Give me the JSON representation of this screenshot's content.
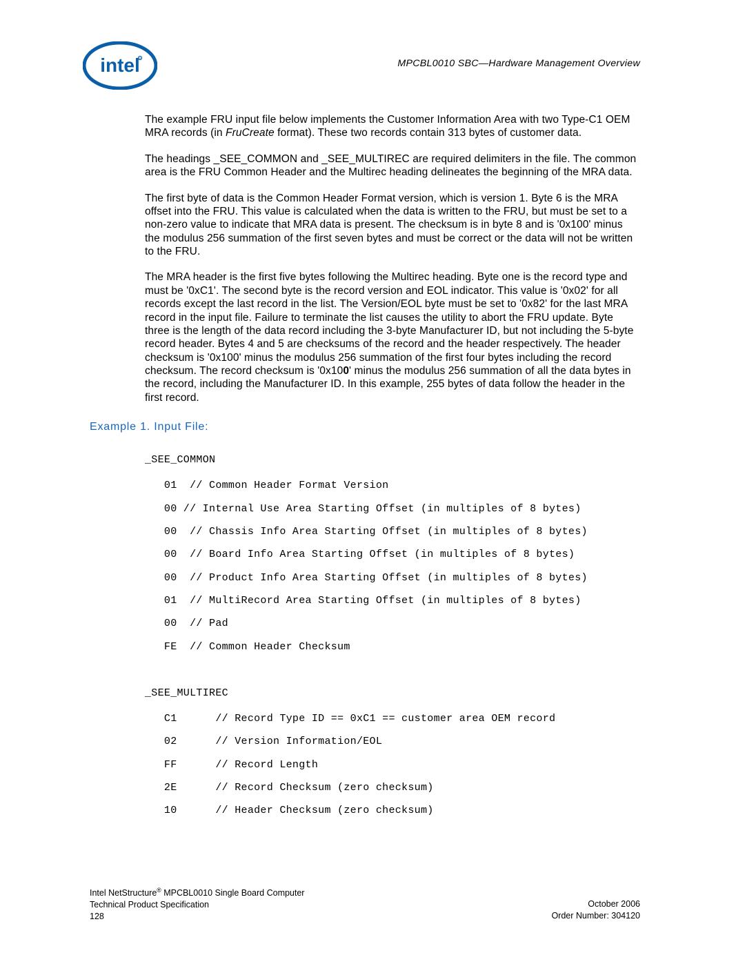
{
  "header": {
    "doc_title": "MPCBL0010 SBC—Hardware Management Overview"
  },
  "logo": {
    "name": "intel-logo"
  },
  "paragraphs": {
    "p1_a": "The example FRU input file below implements the Customer Information Area with two Type-C1 OEM MRA records (in ",
    "p1_b_italic": "FruCreate",
    "p1_c": " format). These two records contain 313 bytes of customer data.",
    "p2": "The headings _SEE_COMMON and _SEE_MULTIREC are required delimiters in the file. The common area is the FRU Common Header and the Multirec heading delineates the beginning of the MRA data.",
    "p3": "The first byte of data is the Common Header Format version, which is version 1. Byte 6 is the MRA offset into the FRU. This value is calculated when the data is written to the FRU, but must be set to a non-zero value to indicate that MRA data is present. The checksum is in byte 8 and is '0x100' minus the modulus 256 summation of the first seven bytes and must be correct or the data will not be written to the FRU.",
    "p4_a": "The MRA header is the first five bytes following the Multirec heading. Byte one is the record type and must be '0xC1'. The second byte is the record version and EOL indicator. This value is '0x02' for all records except the last record in the list. The Version/EOL byte must be set to '0x82' for the last MRA record in the input file. Failure to terminate the list causes the utility to abort the FRU update. Byte three is the length of the data record including the 3-byte Manufacturer ID, but not including the 5-byte record header. Bytes 4 and 5 are checksums of the record and the header respectively. The header checksum is '0x100' minus the modulus 256 summation of the first four bytes including the record checksum. The record checksum is '0x10",
    "p4_b_bold": "0",
    "p4_c": "' minus the modulus 256 summation of all the data bytes in the record, including the Manufacturer ID. In this example, 255 bytes of data follow the header in the first record."
  },
  "example": {
    "heading": "Example 1.  Input File:",
    "section1_label": "_SEE_COMMON",
    "section1_lines": [
      "   01  // Common Header Format Version",
      "   00 // Internal Use Area Starting Offset (in multiples of 8 bytes)",
      "   00  // Chassis Info Area Starting Offset (in multiples of 8 bytes)",
      "   00  // Board Info Area Starting Offset (in multiples of 8 bytes)",
      "   00  // Product Info Area Starting Offset (in multiples of 8 bytes)",
      "   01  // MultiRecord Area Starting Offset (in multiples of 8 bytes)",
      "   00  // Pad",
      "   FE  // Common Header Checksum"
    ],
    "section2_label": "_SEE_MULTIREC",
    "section2_lines": [
      "   C1      // Record Type ID == 0xC1 == customer area OEM record",
      "   02      // Version Information/EOL",
      "   FF      // Record Length",
      "   2E      // Record Checksum (zero checksum)",
      "   10      // Header Checksum (zero checksum)"
    ]
  },
  "footer": {
    "left_line1_a": "Intel NetStructure",
    "left_line1_b": " MPCBL0010 Single Board Computer",
    "left_line2": "Technical Product Specification",
    "left_line3": "128",
    "right_line1": "October 2006",
    "right_line2": "Order Number: 304120"
  }
}
